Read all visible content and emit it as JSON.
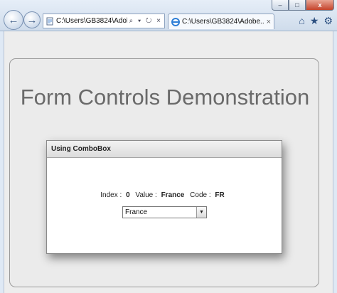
{
  "browser": {
    "window_controls": {
      "minimize": "–",
      "maximize": "□",
      "close": "x"
    },
    "address_bar": {
      "url": "C:\\Users\\GB3824\\Adob",
      "tools": "⌕ ▾ ↻ ×"
    },
    "tab": {
      "title": "C:\\Users\\GB3824\\Adobe...",
      "close": "×"
    },
    "toolbar_icons": [
      "home-icon",
      "favorites-icon",
      "settings-icon"
    ]
  },
  "page": {
    "title": "Form Controls Demonstration",
    "combo_panel": {
      "header": "Using ComboBox",
      "index_label": "Index :",
      "index_value": "0",
      "value_label": "Value :",
      "value_value": "France",
      "code_label": "Code :",
      "code_value": "FR",
      "select_value": "France"
    }
  }
}
